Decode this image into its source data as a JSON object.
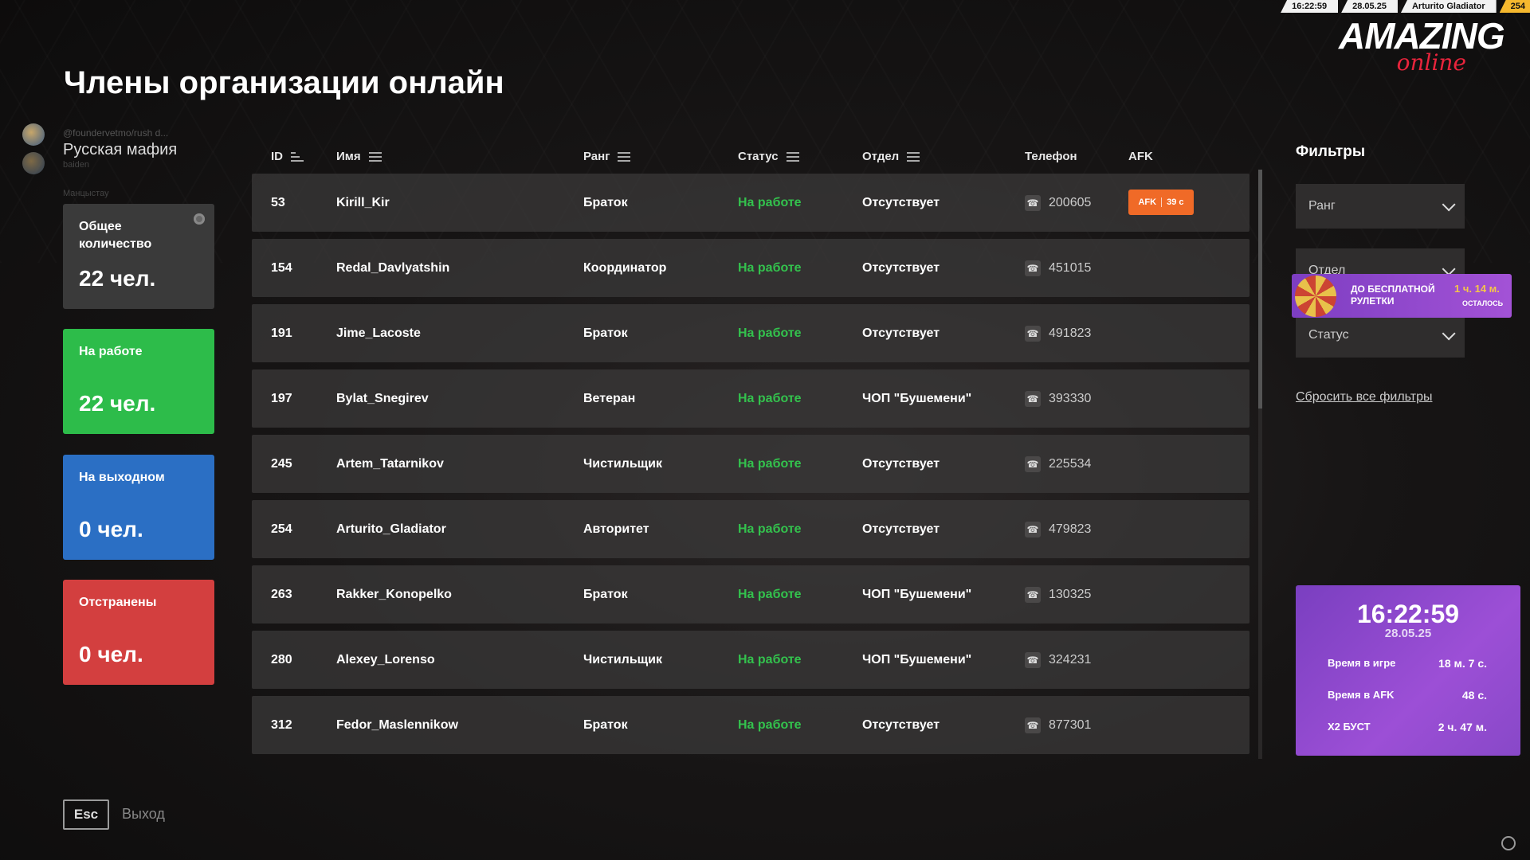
{
  "topbar": {
    "time": "16:22:59",
    "date": "28.05.25",
    "player": "Arturito Gladiator",
    "player_id": "254"
  },
  "logo": {
    "main": "AMAZING",
    "sub": "online"
  },
  "page_title": "Члены организации онлайн",
  "org": {
    "handle": "@foundervetmo/rush d...",
    "name": "Русская мафия",
    "sub1": "baiden",
    "sub2": "Манцыстау"
  },
  "stats": {
    "total": {
      "label": "Общее количество",
      "value": "22 чел."
    },
    "working": {
      "label": "На работе",
      "value": "22 чел."
    },
    "off": {
      "label": "На выходном",
      "value": "0 чел."
    },
    "suspended": {
      "label": "Отстранены",
      "value": "0 чел."
    }
  },
  "table": {
    "headers": {
      "id": "ID",
      "name": "Имя",
      "rank": "Ранг",
      "status": "Статус",
      "dept": "Отдел",
      "phone": "Телефон",
      "afk": "AFK"
    },
    "rows": [
      {
        "id": "53",
        "name": "Kirill_Kir",
        "rank": "Браток",
        "status": "На работе",
        "dept": "Отсутствует",
        "phone": "200605",
        "afk": "AFK",
        "afk_time": "39 с"
      },
      {
        "id": "154",
        "name": "Redal_Davlyatshin",
        "rank": "Координатор",
        "status": "На работе",
        "dept": "Отсутствует",
        "phone": "451015"
      },
      {
        "id": "191",
        "name": "Jime_Lacoste",
        "rank": "Браток",
        "status": "На работе",
        "dept": "Отсутствует",
        "phone": "491823"
      },
      {
        "id": "197",
        "name": "Bylat_Snegirev",
        "rank": "Ветеран",
        "status": "На работе",
        "dept": "ЧОП \"Бушемени\"",
        "phone": "393330"
      },
      {
        "id": "245",
        "name": "Artem_Tatarnikov",
        "rank": "Чистильщик",
        "status": "На работе",
        "dept": "Отсутствует",
        "phone": "225534"
      },
      {
        "id": "254",
        "name": "Arturito_Gladiator",
        "rank": "Авторитет",
        "status": "На работе",
        "dept": "Отсутствует",
        "phone": "479823"
      },
      {
        "id": "263",
        "name": "Rakker_Konopelko",
        "rank": "Браток",
        "status": "На работе",
        "dept": "ЧОП \"Бушемени\"",
        "phone": "130325"
      },
      {
        "id": "280",
        "name": "Alexey_Lorenso",
        "rank": "Чистильщик",
        "status": "На работе",
        "dept": "ЧОП \"Бушемени\"",
        "phone": "324231"
      },
      {
        "id": "312",
        "name": "Fedor_Maslennikow",
        "rank": "Браток",
        "status": "На работе",
        "dept": "Отсутствует",
        "phone": "877301"
      }
    ]
  },
  "filters": {
    "title": "Фильтры",
    "rank": "Ранг",
    "dept": "Отдел",
    "status": "Статус",
    "reset": "Сбросить все фильтры"
  },
  "roulette": {
    "text": "ДО БЕСПЛАТНОЙ РУЛЕТКИ",
    "time": "1 ч. 14 м.",
    "left": "ОСТАЛОСЬ"
  },
  "clock": {
    "time": "16:22:59",
    "date": "28.05.25",
    "ingame_label": "Время в игре",
    "ingame_value": "18 м. 7 с.",
    "afk_label": "Время в AFK",
    "afk_value": "48 с.",
    "boost_label": "X2 БУСТ",
    "boost_value": "2 ч. 47 м."
  },
  "footer": {
    "esc": "Esc",
    "exit": "Выход"
  },
  "colors": {
    "working_card": "#2dbc4a",
    "off_card": "#2b6fc4",
    "suspended_card": "#d33f3f",
    "status_green": "#33c24d",
    "afk_orange": "#f06a27",
    "widget_purple": "#9c4fd6"
  }
}
